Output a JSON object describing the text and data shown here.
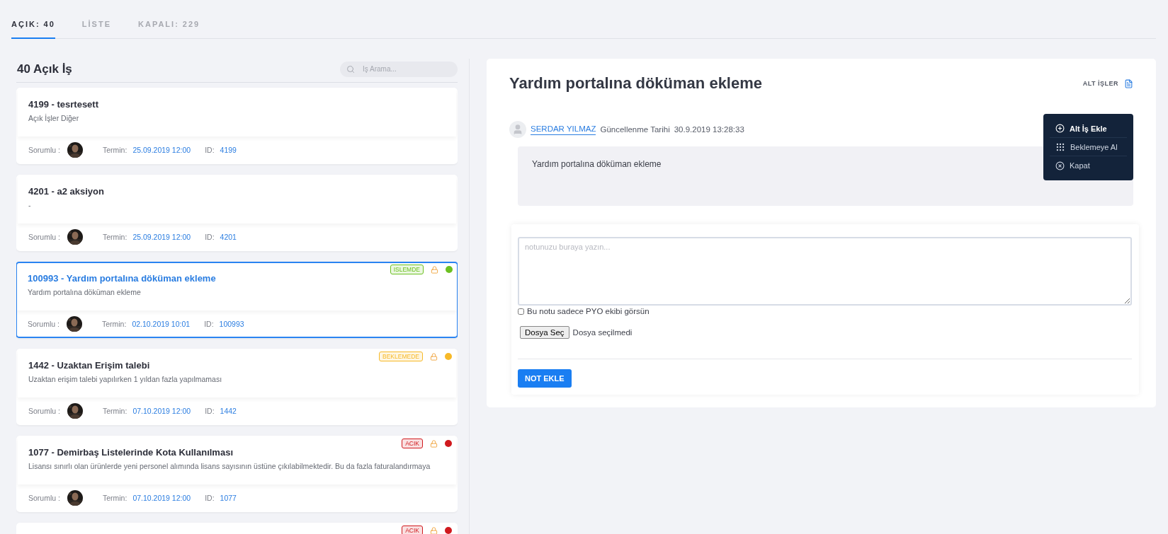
{
  "tabs": [
    {
      "label": "AÇIK: 40",
      "selected": true
    },
    {
      "label": "LİSTE",
      "selected": false
    },
    {
      "label": "KAPALI: 229",
      "selected": false
    }
  ],
  "list": {
    "title": "40 Açık İş",
    "search": {
      "placeholder": "İş Arama..."
    },
    "items": [
      {
        "title": "4199 - tesrtesett",
        "description": "Açık İşler Diğer",
        "owner_label": "Sorumlu :",
        "due_label": "Termin:",
        "due": "25.09.2019 12:00",
        "id_label": "ID:",
        "id": "4199",
        "selected": false
      },
      {
        "title": "4201 - a2 aksiyon",
        "description": "-",
        "owner_label": "Sorumlu :",
        "due_label": "Termin:",
        "due": "25.09.2019 12:00",
        "id_label": "ID:",
        "id": "4201",
        "selected": false
      },
      {
        "title": "100993 - Yardım portalına döküman ekleme",
        "description": "Yardım portalına döküman ekleme",
        "owner_label": "Sorumlu :",
        "due_label": "Termin:",
        "due": "02.10.2019 10:01",
        "id_label": "ID:",
        "id": "100993",
        "selected": true,
        "status": "ISLEMDE",
        "color": "#6cc021"
      },
      {
        "title": "1442 - Uzaktan Erişim talebi",
        "description": "Uzaktan erişim talebi yapılırken 1 yıldan fazla yapılmaması",
        "owner_label": "Sorumlu :",
        "due_label": "Termin:",
        "due": "07.10.2019 12:00",
        "id_label": "ID:",
        "id": "1442",
        "selected": false,
        "status": "BEKLEMEDE",
        "color": "#f7b928"
      },
      {
        "title": "1077 - Demirbaş Listelerinde Kota Kullanılması",
        "description": "Lisansı sınırlı olan ürünlerde yeni personel alımında lisans sayısının üstüne çıkılabilmektedir. Bu da fazla faturalandırmaya",
        "owner_label": "Sorumlu :",
        "due_label": "Termin:",
        "due": "07.10.2019 12:00",
        "id_label": "ID:",
        "id": "1077",
        "selected": false,
        "status": "ACIK",
        "color": "#d0191e"
      },
      {
        "selected": false,
        "status": "ACIK",
        "color": "#d0191e"
      }
    ]
  },
  "detail": {
    "title": "Yardım portalına döküman ekleme",
    "subtasks_link": "ALT İŞLER",
    "comment": {
      "author": "SERDAR YILMAZ",
      "updated_label": "Güncellenme Tarihi",
      "updated": "30.9.2019 13:28:33",
      "text": "Yardım portalına döküman ekleme"
    },
    "menu": [
      {
        "kind": "add",
        "label": "Alt İş Ekle",
        "selected": true
      },
      {
        "kind": "hold",
        "label": "Beklemeye Al",
        "selected": false
      },
      {
        "kind": "close",
        "label": "Kapat",
        "selected": false
      }
    ],
    "note": {
      "placeholder": "notunuzu buraya yazın...",
      "private_label": "Bu notu sadece PYO ekibi görsün",
      "private_checked": false,
      "file_button": "Dosya Seç",
      "file_status": "Dosya seçilmedi",
      "submit": "NOT EKLE"
    }
  }
}
